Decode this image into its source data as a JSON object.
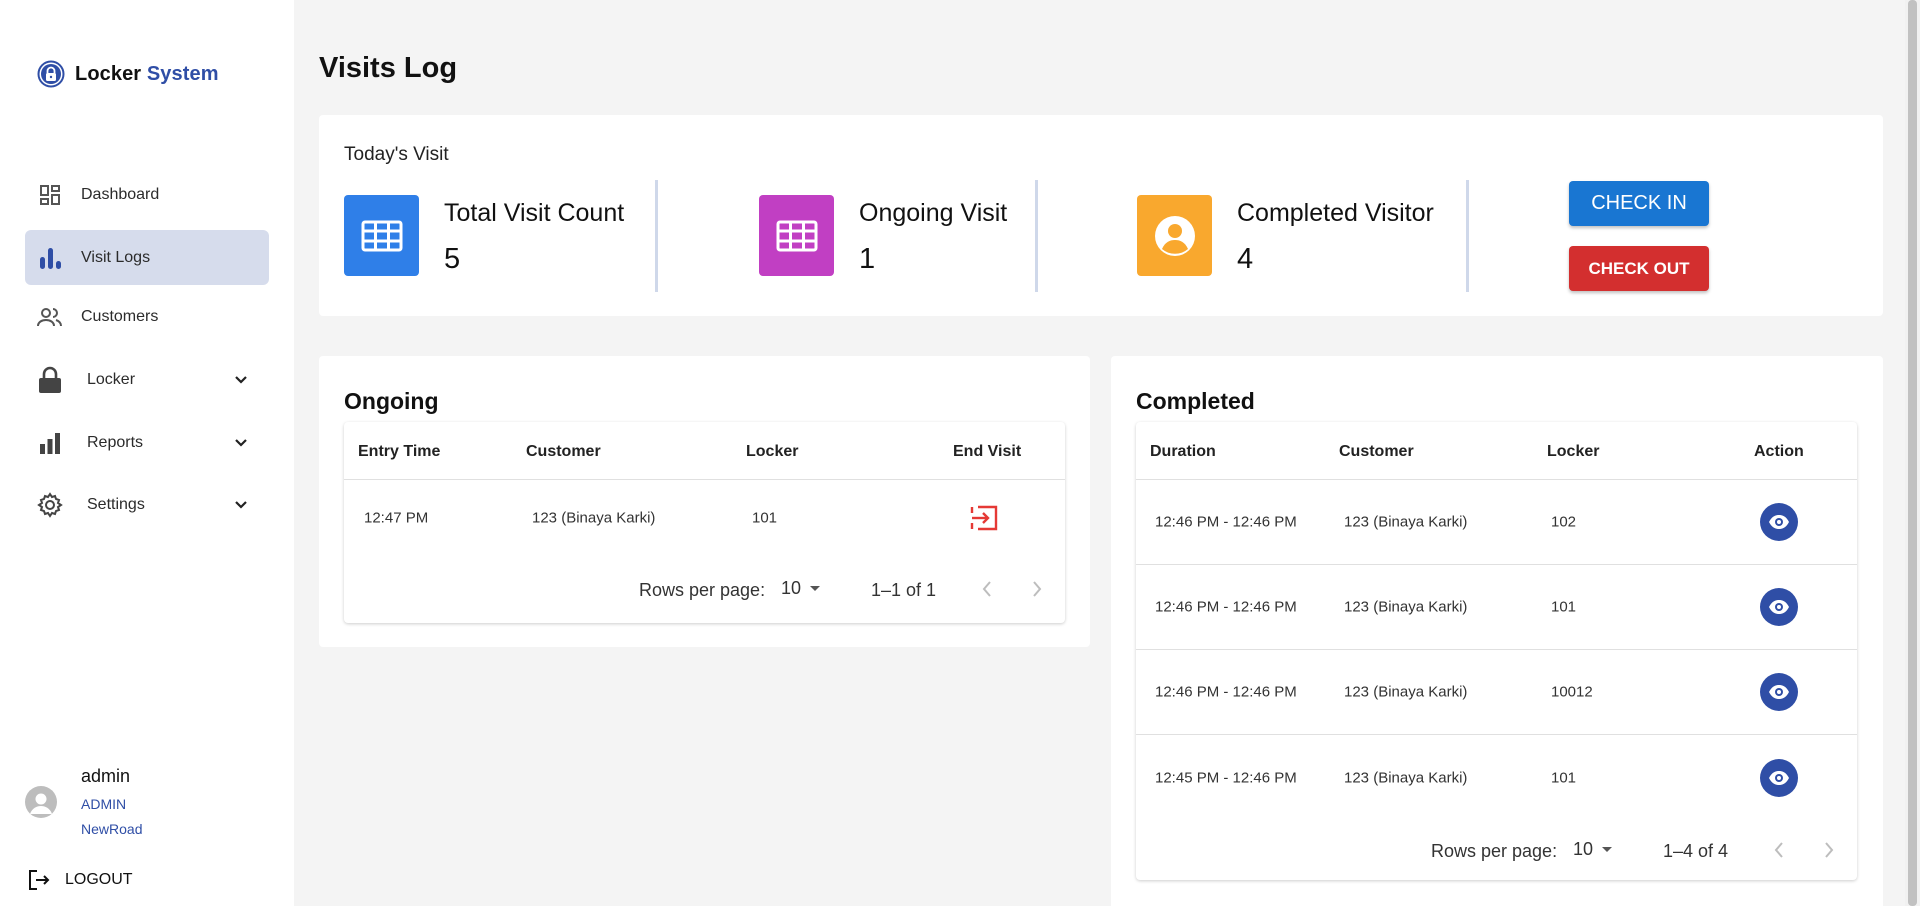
{
  "brand": {
    "name_part1": "Locker",
    "name_part2": "System"
  },
  "sidebar": {
    "items": [
      {
        "label": "Dashboard",
        "icon": "dashboard-icon",
        "active": false
      },
      {
        "label": "Visit Logs",
        "icon": "bar-chart-icon",
        "active": true
      },
      {
        "label": "Customers",
        "icon": "people-icon",
        "active": false
      },
      {
        "label": "Locker",
        "icon": "lock-icon",
        "active": false,
        "expandable": true
      },
      {
        "label": "Reports",
        "icon": "chart-icon",
        "active": false,
        "expandable": true
      },
      {
        "label": "Settings",
        "icon": "gear-icon",
        "active": false,
        "expandable": true
      }
    ]
  },
  "user": {
    "name": "admin",
    "role": "ADMIN",
    "branch": "NewRoad"
  },
  "logout_label": "LOGOUT",
  "page_title": "Visits Log",
  "today": {
    "title": "Today's Visit",
    "stats": [
      {
        "label": "Total Visit Count",
        "value": "5",
        "color": "#2f7fe8",
        "icon": "grid-icon"
      },
      {
        "label": "Ongoing Visit",
        "value": "1",
        "color": "#c13fc3",
        "icon": "grid-icon"
      },
      {
        "label": "Completed Visitor",
        "value": "4",
        "color": "#f9a82e",
        "icon": "person-icon"
      }
    ],
    "check_in_label": "CHECK IN",
    "check_out_label": "CHECK OUT"
  },
  "ongoing": {
    "title": "Ongoing",
    "columns": [
      "Entry Time",
      "Customer",
      "Locker",
      "End Visit"
    ],
    "rows": [
      {
        "entry_time": "12:47 PM",
        "customer": "123 (Binaya Karki)",
        "locker": "101"
      }
    ],
    "pagination": {
      "rows_per_page_label": "Rows per page:",
      "rows_per_page": "10",
      "range": "1–1 of 1"
    }
  },
  "completed": {
    "title": "Completed",
    "columns": [
      "Duration",
      "Customer",
      "Locker",
      "Action"
    ],
    "rows": [
      {
        "duration": "12:46 PM - 12:46 PM",
        "customer": "123 (Binaya Karki)",
        "locker": "102"
      },
      {
        "duration": "12:46 PM - 12:46 PM",
        "customer": "123 (Binaya Karki)",
        "locker": "101"
      },
      {
        "duration": "12:46 PM - 12:46 PM",
        "customer": "123 (Binaya Karki)",
        "locker": "10012"
      },
      {
        "duration": "12:45 PM - 12:46 PM",
        "customer": "123 (Binaya Karki)",
        "locker": "101"
      }
    ],
    "pagination": {
      "rows_per_page_label": "Rows per page:",
      "rows_per_page": "10",
      "range": "1–4 of 4"
    }
  },
  "colors": {
    "accent": "#2f4ea6",
    "check_in": "#1976d2",
    "check_out": "#d32f2f",
    "end_visit": "#e53935"
  }
}
